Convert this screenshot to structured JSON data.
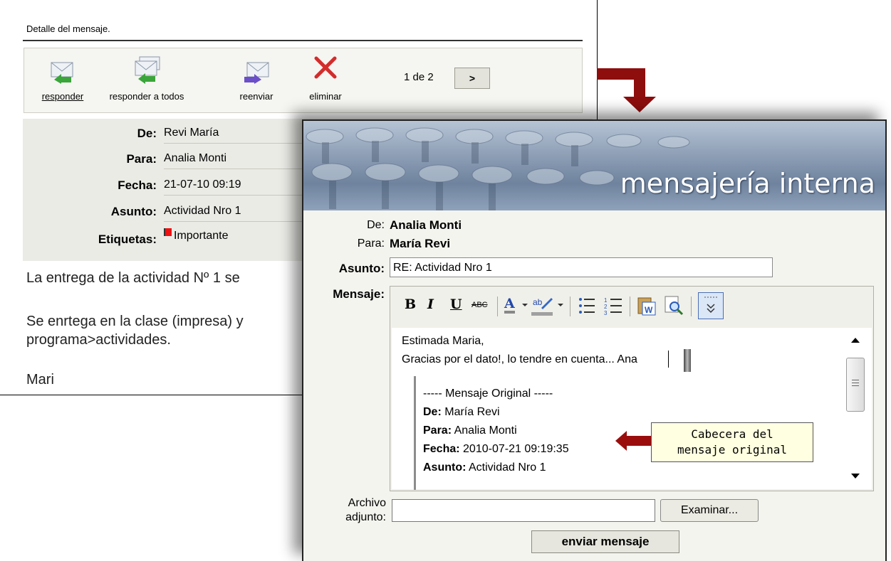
{
  "back": {
    "title": "Detalle del mensaje.",
    "toolbar": {
      "reply": "responder",
      "reply_all": "responder a todos",
      "forward": "reenviar",
      "delete": "eliminar",
      "pager": "1 de 2",
      "next": ">"
    },
    "header": {
      "from_label": "De:",
      "from_value": "Revi María",
      "to_label": "Para:",
      "to_value": "Analia Monti",
      "date_label": "Fecha:",
      "date_value": "21-07-10 09:19",
      "subject_label": "Asunto:",
      "subject_value": "Actividad Nro 1",
      "tags_label": "Etiquetas:",
      "tags_value": "Importante"
    },
    "body": {
      "line1": "La entrega de la actividad Nº 1 se",
      "line2": "Se enrtega en la clase (impresa) y",
      "line3": "programa>actividades.",
      "line4": "Mari"
    }
  },
  "front": {
    "banner_title": "mensajería interna",
    "from_label": "De:",
    "from_value": "Analia Monti",
    "to_label": "Para:",
    "to_value": "María Revi",
    "subject_label": "Asunto:",
    "subject_value": "RE: Actividad Nro 1",
    "message_label": "Mensaje:",
    "editor_toolbar": {
      "bold": "B",
      "italic": "I",
      "underline": "U",
      "strike": "ABC",
      "font_color": "A"
    },
    "editor": {
      "line1": "Estimada Maria,",
      "line2": "Gracias por el dato!, lo tendre en cuenta... Ana",
      "quote_header": "----- Mensaje Original -----",
      "q_from_label": "De:",
      "q_from_value": "María Revi",
      "q_to_label": "Para:",
      "q_to_value": "Analia Monti",
      "q_date_label": "Fecha:",
      "q_date_value": "2010-07-21 09:19:35",
      "q_subject_label": "Asunto:",
      "q_subject_value": "Actividad Nro 1"
    },
    "attach_label_1": "Archivo",
    "attach_label_2": "adjunto:",
    "browse": "Examinar...",
    "send": "enviar mensaje",
    "callout_1": "Cabecera del",
    "callout_2": "mensaje original"
  },
  "colors": {
    "arrow": "#8e0d0d",
    "banner": "#6f839e",
    "tooltip": "#ffffe1"
  }
}
